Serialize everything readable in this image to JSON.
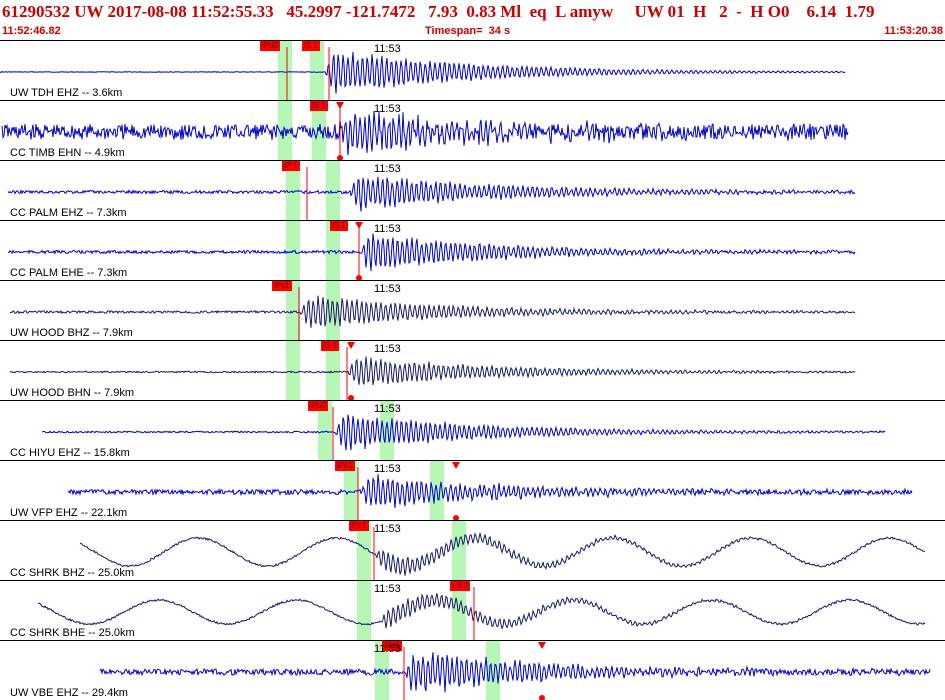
{
  "header": {
    "title": "61290532 UW 2017-08-08 11:52:55.33   45.2997 -121.7472   7.93  0.83 Ml  eq  L amyw     UW 01  H   2  -  H O0    6.14  1.79",
    "start_time": "11:52:46.82",
    "timespan": "Timespan=  34 s",
    "end_time": "11:53:20.38"
  },
  "colors": {
    "header": "#cc0000",
    "trace_blue": "#0000cc",
    "trace_navy": "#1a1a66",
    "window": "#b6f7b6",
    "pick": "#ff0000"
  },
  "minute_label": "11:53",
  "traces": [
    {
      "label": "UW TDH EHZ -- 3.6km",
      "picks": [
        "iPd0",
        "iS 1"
      ]
    },
    {
      "label": "CC TIMB EHN -- 4.9km",
      "picks": [
        "iS 1"
      ]
    },
    {
      "label": "CC PALM EHZ -- 7.3km",
      "picks": [
        "iP 1"
      ]
    },
    {
      "label": "CC PALM EHE -- 7.3km",
      "picks": [
        "iS 1"
      ]
    },
    {
      "label": "UW HOOD BHZ -- 7.9km",
      "picks": [
        "iPc1"
      ]
    },
    {
      "label": "UW HOOD BHN -- 7.9km",
      "picks": [
        "iS 1"
      ]
    },
    {
      "label": "CC HIYU EHZ -- 15.8km",
      "picks": [
        "iPd0"
      ]
    },
    {
      "label": "UW VFP EHZ -- 22.1km",
      "picks": [
        "iPc1"
      ]
    },
    {
      "label": "CC SHRK BHZ -- 25.0km",
      "picks": [
        "iPc1"
      ]
    },
    {
      "label": "CC SHRK BHE -- 25.0km",
      "picks": [
        "eS 2"
      ]
    },
    {
      "label": "UW VBE EHZ -- 29.4km",
      "picks": [
        "iPd1"
      ]
    }
  ]
}
